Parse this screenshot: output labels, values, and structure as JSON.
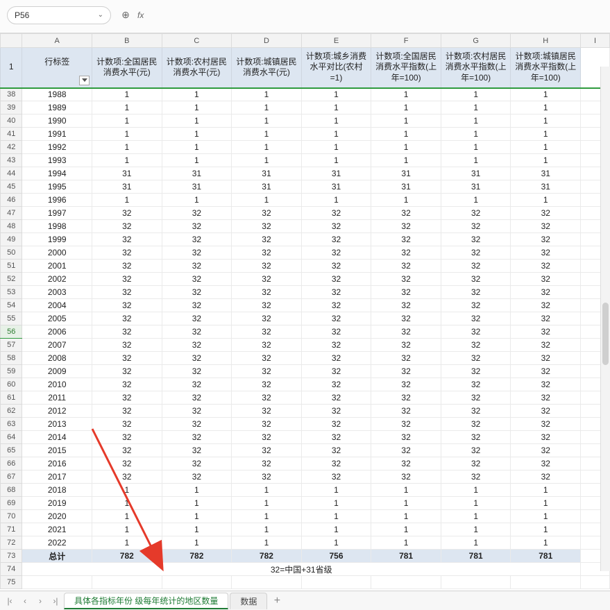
{
  "namebox": {
    "ref": "P56",
    "chev": "⌄"
  },
  "fx": {
    "magnify": "⊕",
    "fx": "fx"
  },
  "columns": [
    "A",
    "B",
    "C",
    "D",
    "E",
    "F",
    "G",
    "H",
    "I"
  ],
  "headerRowNum": "1",
  "header": {
    "rowlabel": "行标签",
    "cols": [
      "计数项:全国居民消费水平(元)",
      "计数项:农村居民消费水平(元)",
      "计数项:城镇居民消费水平(元)",
      "计数项:城乡消费水平对比(农村=1)",
      "计数项:全国居民消费水平指数(上年=100)",
      "计数项:农村居民消费水平指数(上年=100)",
      "计数项:城镇居民消费水平指数(上年=100)"
    ]
  },
  "rows": [
    {
      "num": "38",
      "label": "1988",
      "v": [
        "1",
        "1",
        "1",
        "1",
        "1",
        "1",
        "1"
      ]
    },
    {
      "num": "39",
      "label": "1989",
      "v": [
        "1",
        "1",
        "1",
        "1",
        "1",
        "1",
        "1"
      ]
    },
    {
      "num": "40",
      "label": "1990",
      "v": [
        "1",
        "1",
        "1",
        "1",
        "1",
        "1",
        "1"
      ]
    },
    {
      "num": "41",
      "label": "1991",
      "v": [
        "1",
        "1",
        "1",
        "1",
        "1",
        "1",
        "1"
      ]
    },
    {
      "num": "42",
      "label": "1992",
      "v": [
        "1",
        "1",
        "1",
        "1",
        "1",
        "1",
        "1"
      ]
    },
    {
      "num": "43",
      "label": "1993",
      "v": [
        "1",
        "1",
        "1",
        "1",
        "1",
        "1",
        "1"
      ]
    },
    {
      "num": "44",
      "label": "1994",
      "v": [
        "31",
        "31",
        "31",
        "31",
        "31",
        "31",
        "31"
      ]
    },
    {
      "num": "45",
      "label": "1995",
      "v": [
        "31",
        "31",
        "31",
        "31",
        "31",
        "31",
        "31"
      ]
    },
    {
      "num": "46",
      "label": "1996",
      "v": [
        "1",
        "1",
        "1",
        "1",
        "1",
        "1",
        "1"
      ]
    },
    {
      "num": "47",
      "label": "1997",
      "v": [
        "32",
        "32",
        "32",
        "32",
        "32",
        "32",
        "32"
      ]
    },
    {
      "num": "48",
      "label": "1998",
      "v": [
        "32",
        "32",
        "32",
        "32",
        "32",
        "32",
        "32"
      ]
    },
    {
      "num": "49",
      "label": "1999",
      "v": [
        "32",
        "32",
        "32",
        "32",
        "32",
        "32",
        "32"
      ]
    },
    {
      "num": "50",
      "label": "2000",
      "v": [
        "32",
        "32",
        "32",
        "32",
        "32",
        "32",
        "32"
      ]
    },
    {
      "num": "51",
      "label": "2001",
      "v": [
        "32",
        "32",
        "32",
        "32",
        "32",
        "32",
        "32"
      ]
    },
    {
      "num": "52",
      "label": "2002",
      "v": [
        "32",
        "32",
        "32",
        "32",
        "32",
        "32",
        "32"
      ]
    },
    {
      "num": "53",
      "label": "2003",
      "v": [
        "32",
        "32",
        "32",
        "32",
        "32",
        "32",
        "32"
      ]
    },
    {
      "num": "54",
      "label": "2004",
      "v": [
        "32",
        "32",
        "32",
        "32",
        "32",
        "32",
        "32"
      ]
    },
    {
      "num": "55",
      "label": "2005",
      "v": [
        "32",
        "32",
        "32",
        "32",
        "32",
        "32",
        "32"
      ]
    },
    {
      "num": "56",
      "label": "2006",
      "v": [
        "32",
        "32",
        "32",
        "32",
        "32",
        "32",
        "32"
      ],
      "selected": true
    },
    {
      "num": "57",
      "label": "2007",
      "v": [
        "32",
        "32",
        "32",
        "32",
        "32",
        "32",
        "32"
      ]
    },
    {
      "num": "58",
      "label": "2008",
      "v": [
        "32",
        "32",
        "32",
        "32",
        "32",
        "32",
        "32"
      ]
    },
    {
      "num": "59",
      "label": "2009",
      "v": [
        "32",
        "32",
        "32",
        "32",
        "32",
        "32",
        "32"
      ]
    },
    {
      "num": "60",
      "label": "2010",
      "v": [
        "32",
        "32",
        "32",
        "32",
        "32",
        "32",
        "32"
      ]
    },
    {
      "num": "61",
      "label": "2011",
      "v": [
        "32",
        "32",
        "32",
        "32",
        "32",
        "32",
        "32"
      ]
    },
    {
      "num": "62",
      "label": "2012",
      "v": [
        "32",
        "32",
        "32",
        "32",
        "32",
        "32",
        "32"
      ]
    },
    {
      "num": "63",
      "label": "2013",
      "v": [
        "32",
        "32",
        "32",
        "32",
        "32",
        "32",
        "32"
      ]
    },
    {
      "num": "64",
      "label": "2014",
      "v": [
        "32",
        "32",
        "32",
        "32",
        "32",
        "32",
        "32"
      ]
    },
    {
      "num": "65",
      "label": "2015",
      "v": [
        "32",
        "32",
        "32",
        "32",
        "32",
        "32",
        "32"
      ]
    },
    {
      "num": "66",
      "label": "2016",
      "v": [
        "32",
        "32",
        "32",
        "32",
        "32",
        "32",
        "32"
      ]
    },
    {
      "num": "67",
      "label": "2017",
      "v": [
        "32",
        "32",
        "32",
        "32",
        "32",
        "32",
        "32"
      ]
    },
    {
      "num": "68",
      "label": "2018",
      "v": [
        "1",
        "1",
        "1",
        "1",
        "1",
        "1",
        "1"
      ]
    },
    {
      "num": "69",
      "label": "2019",
      "v": [
        "1",
        "1",
        "1",
        "1",
        "1",
        "1",
        "1"
      ]
    },
    {
      "num": "70",
      "label": "2020",
      "v": [
        "1",
        "1",
        "1",
        "1",
        "1",
        "1",
        "1"
      ]
    },
    {
      "num": "71",
      "label": "2021",
      "v": [
        "1",
        "1",
        "1",
        "1",
        "1",
        "1",
        "1"
      ]
    },
    {
      "num": "72",
      "label": "2022",
      "v": [
        "1",
        "1",
        "1",
        "1",
        "1",
        "1",
        "1"
      ]
    }
  ],
  "total": {
    "num": "73",
    "label": "总计",
    "v": [
      "782",
      "782",
      "782",
      "756",
      "781",
      "781",
      "781"
    ]
  },
  "note": {
    "num": "74",
    "text": "32=中国+31省级"
  },
  "emptyRow": {
    "num": "75"
  },
  "tabs": {
    "nav": {
      "first": "|‹",
      "prev": "‹",
      "next": "›",
      "last": "›|"
    },
    "items": [
      {
        "label": "具体各指标年份 级每年统计的地区数量",
        "active": true
      },
      {
        "label": "数据",
        "active": false
      }
    ],
    "add": "+"
  }
}
